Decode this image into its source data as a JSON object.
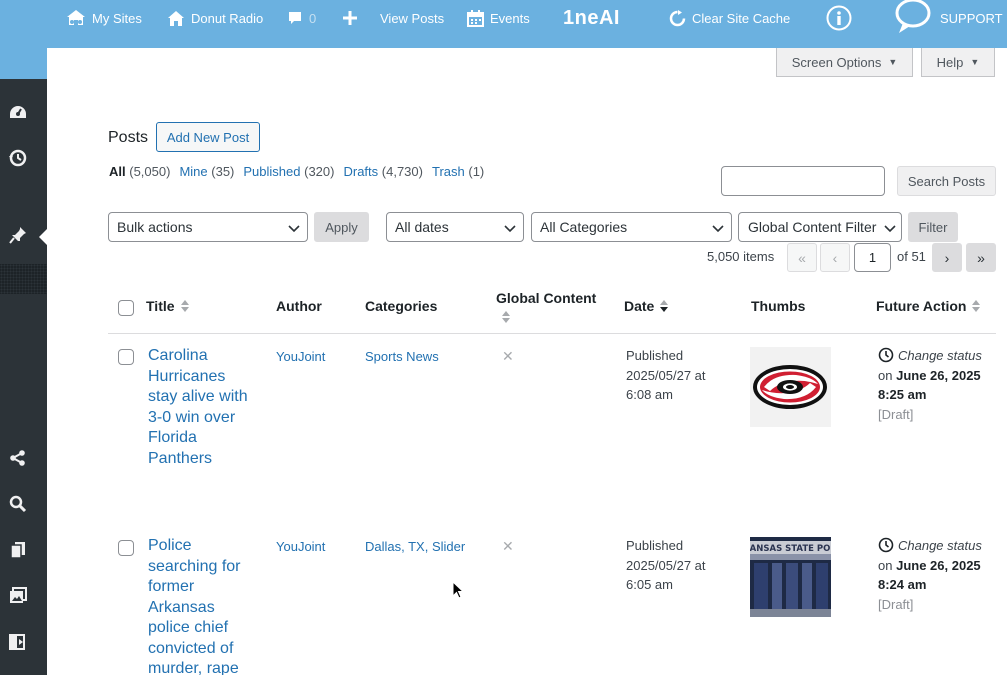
{
  "topbar": {
    "my_sites": "My Sites",
    "site_name": "Donut Radio",
    "comments_count": "0",
    "view_posts": "View Posts",
    "events": "Events",
    "oneai_logo": "1neAI",
    "clear_cache": "Clear Site Cache",
    "support": "SUPPORT",
    "background": "#6bb1e0"
  },
  "screen_meta": {
    "screen_options": "Screen Options",
    "help": "Help"
  },
  "page": {
    "title": "Posts",
    "add_new": "Add New Post"
  },
  "views": [
    {
      "label": "All",
      "count": "(5,050)",
      "current": true
    },
    {
      "label": "Mine",
      "count": "(35)"
    },
    {
      "label": "Published",
      "count": "(320)"
    },
    {
      "label": "Drafts",
      "count": "(4,730)"
    },
    {
      "label": "Trash",
      "count": "(1)"
    }
  ],
  "search": {
    "button": "Search Posts",
    "value": ""
  },
  "filters": {
    "bulk_actions": "Bulk actions",
    "apply": "Apply",
    "dates": "All dates",
    "categories": "All Categories",
    "global_content": "Global Content Filter",
    "filter": "Filter"
  },
  "pagination": {
    "items": "5,050 items",
    "first": "«",
    "prev": "‹",
    "current_page": "1",
    "of_total": "of 51",
    "next": "›",
    "last": "»"
  },
  "table": {
    "columns": [
      "Title",
      "Author",
      "Categories",
      "Global Content",
      "Date",
      "Thumbs",
      "Future Action"
    ],
    "rows": [
      {
        "title": "Carolina Hurricanes stay alive with 3-0 win over Florida Panthers",
        "author": "YouJoint",
        "categories": "Sports News",
        "global": "✕",
        "date_status": "Published",
        "date": "2025/05/27 at",
        "time": "6:08 am",
        "thumb": "carolina-hurricanes-logo",
        "action": "Change status",
        "on": "on",
        "action_date": "June 26, 2025",
        "action_time": "8:25 am",
        "action_target": "[Draft]"
      },
      {
        "title": "Police searching for former Arkansas police chief convicted of murder, rape",
        "author": "YouJoint",
        "categories": "Dallas, TX, Slider",
        "global": "✕",
        "date_status": "Published",
        "date": "2025/05/27 at",
        "time": "6:05 am",
        "thumb": "arkansas-state-police-building",
        "thumb_text": "ANSAS STATE PO",
        "action": "Change status",
        "on": "on",
        "action_date": "June 26, 2025",
        "action_time": "8:24 am",
        "action_target": "[Draft]"
      }
    ]
  },
  "colors": {
    "link": "#2271b1",
    "sidebar": "#2c3338",
    "admin_bar": "#6bb1e0"
  }
}
